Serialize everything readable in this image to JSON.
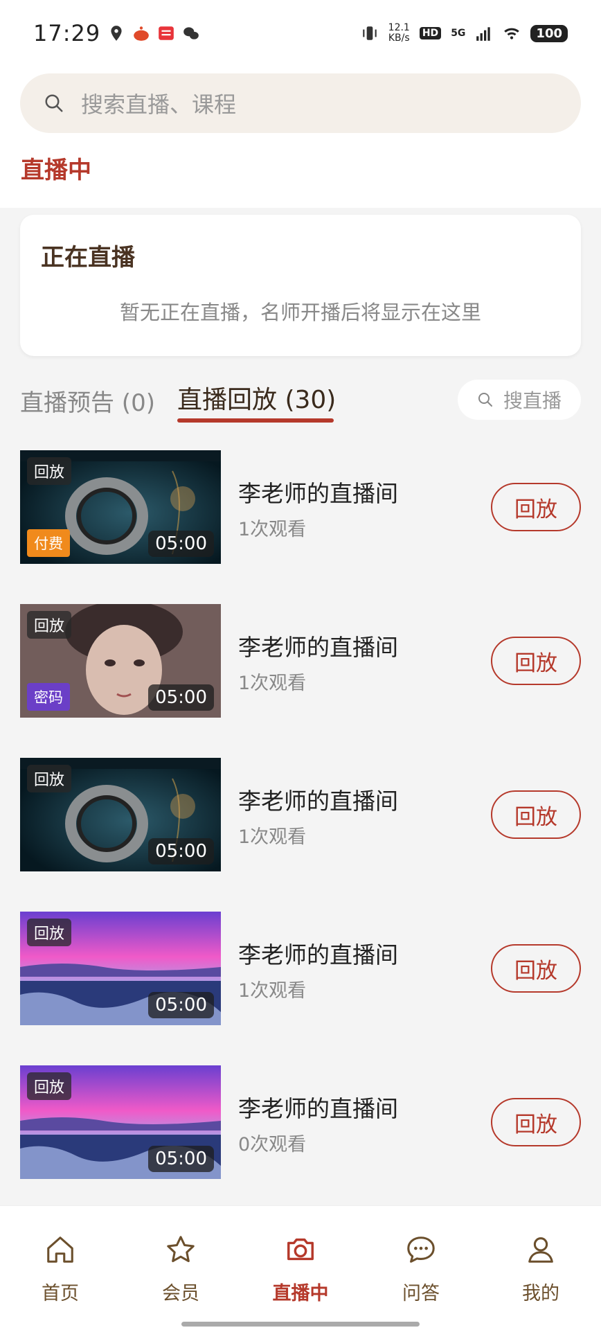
{
  "status_bar": {
    "time": "17:29",
    "net_speed_value": "12.1",
    "net_speed_unit": "KB/s",
    "hd": "HD",
    "network": "5G",
    "battery": "100"
  },
  "search": {
    "placeholder": "搜索直播、课程"
  },
  "page_heading": "直播中",
  "live_now": {
    "title": "正在直播",
    "empty_text": "暂无正在直播，名师开播后将显示在这里"
  },
  "tabs": [
    {
      "label": "直播预告 (0)",
      "active": false
    },
    {
      "label": "直播回放 (30)",
      "active": true
    }
  ],
  "mini_search": {
    "placeholder": "搜直播"
  },
  "replays": [
    {
      "badge": "回放",
      "pay_badge": "付费",
      "pay_color": "#f08a1c",
      "duration": "05:00",
      "title": "李老师的直播间",
      "views": "1次观看",
      "button": "回放",
      "thumb": "ring"
    },
    {
      "badge": "回放",
      "pay_badge": "密码",
      "pay_color": "#6b3fc7",
      "duration": "05:00",
      "title": "李老师的直播间",
      "views": "1次观看",
      "button": "回放",
      "thumb": "portrait"
    },
    {
      "badge": "回放",
      "pay_badge": "",
      "pay_color": "",
      "duration": "05:00",
      "title": "李老师的直播间",
      "views": "1次观看",
      "button": "回放",
      "thumb": "ring"
    },
    {
      "badge": "回放",
      "pay_badge": "",
      "pay_color": "",
      "duration": "05:00",
      "title": "李老师的直播间",
      "views": "1次观看",
      "button": "回放",
      "thumb": "lake"
    },
    {
      "badge": "回放",
      "pay_badge": "",
      "pay_color": "",
      "duration": "05:00",
      "title": "李老师的直播间",
      "views": "0次观看",
      "button": "回放",
      "thumb": "lake"
    }
  ],
  "bottom_nav": [
    {
      "label": "首页",
      "icon": "home-icon",
      "active": false
    },
    {
      "label": "会员",
      "icon": "star-icon",
      "active": false
    },
    {
      "label": "直播中",
      "icon": "camera-icon",
      "active": true
    },
    {
      "label": "问答",
      "icon": "chat-icon",
      "active": false
    },
    {
      "label": "我的",
      "icon": "user-icon",
      "active": false
    }
  ],
  "colors": {
    "accent": "#b5392b",
    "search_bg": "#f4efe9"
  }
}
